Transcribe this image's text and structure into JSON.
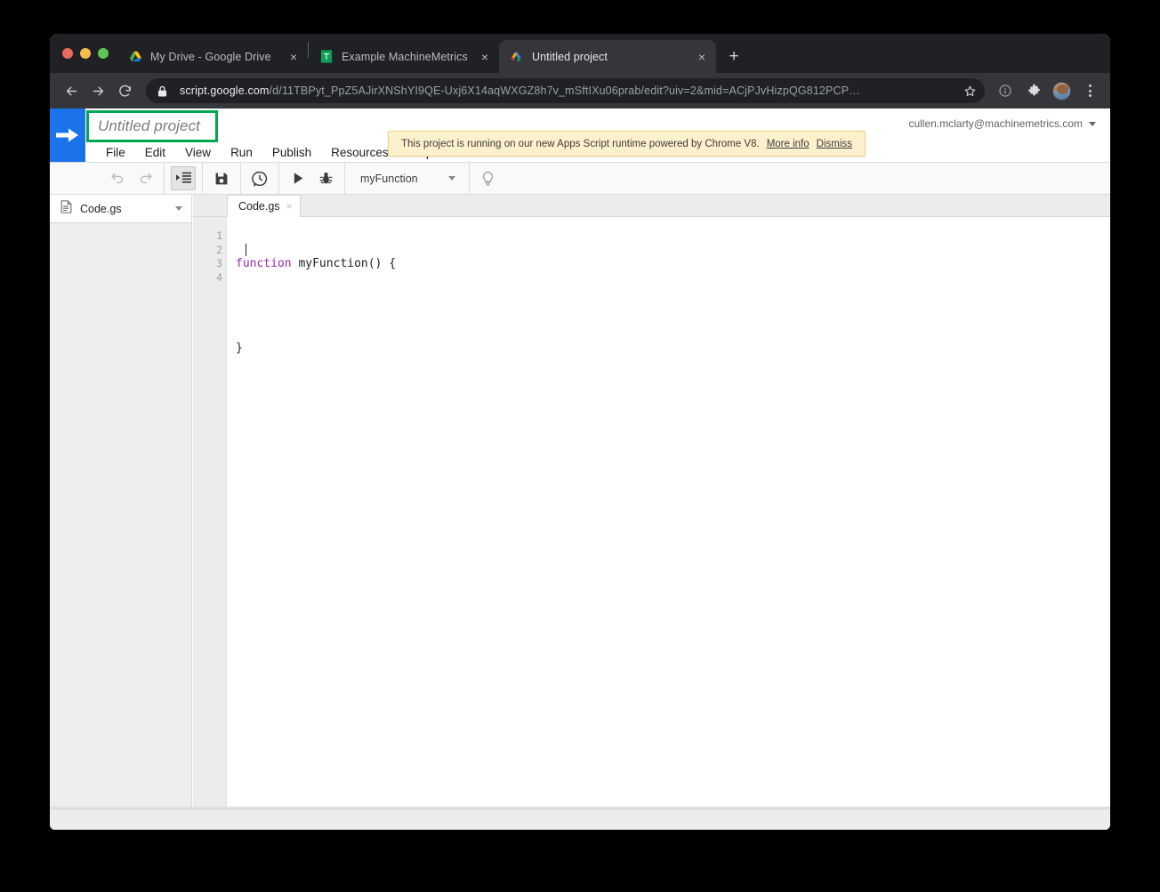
{
  "browser": {
    "traffic_lights": [
      "close",
      "minimize",
      "zoom"
    ],
    "tabs": [
      {
        "title": "My Drive - Google Drive",
        "favicon": "google-drive-icon",
        "active": false,
        "close_label": "×"
      },
      {
        "title": "Example MachineMetrics Impor",
        "favicon": "google-sheets-icon",
        "active": false,
        "close_label": "×"
      },
      {
        "title": "Untitled project",
        "favicon": "apps-script-icon",
        "active": true,
        "close_label": "×"
      }
    ],
    "new_tab_label": "+",
    "nav": {
      "back": "←",
      "forward": "→",
      "reload": "⟳"
    },
    "omnibox": {
      "domain": "script.google.com",
      "path": "/d/11TBPyt_PpZ5AJirXNShYI9QE-Uxj6X14aqWXGZ8h7v_mSftIXu06prab/edit?uiv=2&mid=ACjPJvHizpQG812PCP…",
      "lock_icon": "lock-icon",
      "star_icon": "bookmark-star-icon"
    },
    "toolbar_icons": [
      "info-circle-icon",
      "extensions-puzzle-icon",
      "profile-avatar",
      "three-dot-menu-icon"
    ]
  },
  "app": {
    "logo": "apps-script-arrow-logo",
    "project_title": "Untitled project",
    "title_highlight_color": "#00a650",
    "menus": [
      "File",
      "Edit",
      "View",
      "Run",
      "Publish",
      "Resources",
      "Help"
    ],
    "account_email": "cullen.mclarty@machinemetrics.com",
    "banner": {
      "message": "This project is running on our new Apps Script runtime powered by Chrome V8.",
      "more_info": "More info",
      "dismiss": "Dismiss",
      "background": "#fdf0cd"
    },
    "toolbar": {
      "undo": "undo-icon",
      "redo": "redo-icon",
      "indent": "indent-icon",
      "save": "save-floppy-icon",
      "history": "version-history-clock-icon",
      "run": "run-play-icon",
      "debug": "debug-bug-icon",
      "function_selected": "myFunction",
      "hint": "lightbulb-icon"
    },
    "sidebar": {
      "file_icon": "script-file-icon",
      "file_name": "Code.gs"
    },
    "editor": {
      "tab_name": "Code.gs",
      "tab_close": "×",
      "line_numbers": [
        "1",
        "2",
        "3",
        "4"
      ],
      "code_lines": [
        {
          "keyword": "function",
          "rest": " myFunction() {"
        },
        {
          "keyword": "",
          "rest": "  "
        },
        {
          "keyword": "",
          "rest": "}"
        },
        {
          "keyword": "",
          "rest": ""
        }
      ],
      "keyword_color": "#9c27b0"
    },
    "status_bar_text": ""
  }
}
